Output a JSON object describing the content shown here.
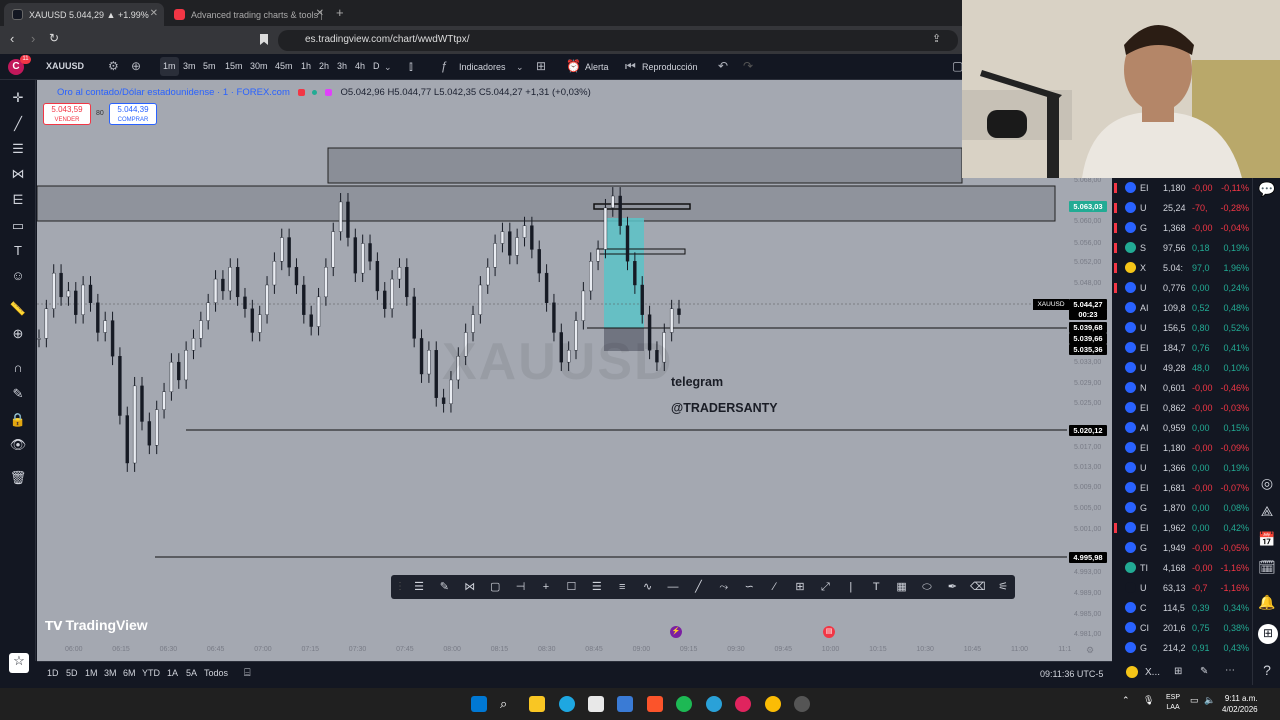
{
  "browser": {
    "tabs": [
      {
        "title": "XAUUSD 5.044,29 ▲ +1.99% do",
        "active": true
      },
      {
        "title": "Advanced trading charts & tools | Tra",
        "active": false
      }
    ],
    "url": "es.tradingview.com/chart/wwdWTtpx/"
  },
  "toolbar": {
    "avatar": "C",
    "notification_count": "11",
    "symbol": "XAUUSD",
    "timeframes": [
      "1m",
      "3m",
      "5m",
      "15m",
      "30m",
      "45m",
      "1h",
      "2h",
      "3h",
      "4h",
      "D"
    ],
    "active_timeframe": "1m",
    "indicators_label": "Indicadores",
    "alert_label": "Alerta",
    "replay_label": "Reproducción"
  },
  "legend": {
    "title": "Oro al contado/Dólar estadounidense · 1 · FOREX.com",
    "ohlc": "O5.042,96 H5.044,77 L5.042,35 C5.044,27 +1,31 (+0,03%)",
    "sell_price": "5.043,59",
    "sell_label": "VENDER",
    "spread": "80",
    "buy_price": "5.044,39",
    "buy_label": "COMPRAR"
  },
  "chart_watermark": "XAUUSD",
  "overlay_text": {
    "line1": "telegram",
    "line2": "@TRADERSANTY"
  },
  "brand": "TradingView",
  "chart_data": {
    "type": "line",
    "symbol": "XAUUSD",
    "x": [
      "06:00",
      "06:15",
      "06:30",
      "06:45",
      "07:00",
      "07:15",
      "07:30",
      "07:45",
      "08:00",
      "08:15",
      "08:30",
      "08:45",
      "09:00",
      "09:15",
      "09:30",
      "09:45",
      "10:00",
      "10:15",
      "10:30",
      "10:45",
      "11:00",
      "11:1"
    ],
    "y_ticks": [
      "5.068,00",
      "5.063,03",
      "5.060,00",
      "5.056,00",
      "5.052,00",
      "5.048,00",
      "5.044,27",
      "5.039,68",
      "5.039,66",
      "5.035,36",
      "5.033,00",
      "5.029,00",
      "5.025,00",
      "5.020,12",
      "5.017,00",
      "5.013,00",
      "5.009,00",
      "5.005,00",
      "5.001,00",
      "4.995,98",
      "4.993,00",
      "4.989,00",
      "4.985,00",
      "4.981,00"
    ],
    "price_labels": {
      "top_zone": "5.063,03",
      "current": "5.044,27",
      "countdown": "00:23",
      "level_a": "5.039,68",
      "level_b": "5.039,66",
      "level_c": "5.035,36",
      "support": "5.020,12",
      "low_line": "4.995,98"
    },
    "ylim": [
      4980,
      5069
    ],
    "series": [
      {
        "values": [
          5040,
          5045,
          5051,
          5047,
          5048,
          5044,
          5049,
          5046,
          5041,
          5043,
          5037,
          5027,
          5019,
          5032,
          5026,
          5022,
          5028,
          5031,
          5036,
          5033,
          5038,
          5040,
          5043,
          5046,
          5050,
          5048,
          5052,
          5047,
          5045,
          5041,
          5044,
          5049,
          5053,
          5057,
          5052,
          5049,
          5044,
          5042,
          5047,
          5052,
          5058,
          5063,
          5057,
          5051,
          5056,
          5053,
          5048,
          5045,
          5050,
          5052,
          5047,
          5040,
          5034,
          5038,
          5030,
          5029,
          5033,
          5037,
          5041,
          5044,
          5049,
          5052,
          5056,
          5058,
          5054,
          5057,
          5059,
          5055,
          5051,
          5046,
          5041,
          5036,
          5038,
          5043,
          5048,
          5053,
          5055,
          5062,
          5064,
          5059,
          5053,
          5049,
          5044,
          5038,
          5036,
          5041,
          5045,
          5044
        ]
      }
    ]
  },
  "drawing_toolbar": [
    "list-icon",
    "pencil-icon",
    "pitchfork-icon",
    "rect-icon",
    "hline-icon",
    "crosshair-icon",
    "note-icon",
    "lines-icon",
    "lines2-icon",
    "wave-icon",
    "minus-icon",
    "line-icon",
    "path-icon",
    "curve-icon",
    "brush-icon",
    "frame-icon",
    "ruler-icon",
    "pipe-icon",
    "text-icon",
    "grid-icon",
    "ellipse-icon",
    "pen-icon",
    "eraser-icon",
    "highlighter-icon"
  ],
  "range_bar": {
    "ranges": [
      "1D",
      "5D",
      "1M",
      "3M",
      "6M",
      "YTD",
      "1A",
      "5A",
      "Todos"
    ],
    "clock": "09:11:36 UTC-5"
  },
  "watchlist": [
    {
      "sym": "EI",
      "last": "1,180",
      "chg": "-0,00",
      "pct": "-0,11%",
      "up": false,
      "icon_color": "#2962ff"
    },
    {
      "sym": "U",
      "last": "25,24",
      "chg": "-70,",
      "pct": "-0,28%",
      "up": false,
      "icon_color": "#2962ff"
    },
    {
      "sym": "G",
      "last": "1,368",
      "chg": "-0,00",
      "pct": "-0,04%",
      "up": false,
      "icon_color": "#2962ff"
    },
    {
      "sym": "S",
      "last": "97,56",
      "chg": "0,18",
      "pct": "0,19%",
      "up": true,
      "icon_color": "#22ab94"
    },
    {
      "sym": "X",
      "last": "5.04:",
      "chg": "97,0",
      "pct": "1,96%",
      "up": true,
      "icon_color": "#f5c518"
    },
    {
      "sym": "U",
      "last": "0,776",
      "chg": "0,00",
      "pct": "0,24%",
      "up": true,
      "icon_color": "#2962ff"
    },
    {
      "sym": "AI",
      "last": "109,8",
      "chg": "0,52",
      "pct": "0,48%",
      "up": true,
      "icon_color": "#2962ff"
    },
    {
      "sym": "U",
      "last": "156,5",
      "chg": "0,80",
      "pct": "0,52%",
      "up": true,
      "icon_color": "#2962ff"
    },
    {
      "sym": "EI",
      "last": "184,7",
      "chg": "0,76",
      "pct": "0,41%",
      "up": true,
      "icon_color": "#2962ff"
    },
    {
      "sym": "U",
      "last": "49,28",
      "chg": "48,0",
      "pct": "0,10%",
      "up": true,
      "icon_color": "#2962ff"
    },
    {
      "sym": "N",
      "last": "0,601",
      "chg": "-0,00",
      "pct": "-0,46%",
      "up": false,
      "icon_color": "#2962ff"
    },
    {
      "sym": "EI",
      "last": "0,862",
      "chg": "-0,00",
      "pct": "-0,03%",
      "up": false,
      "icon_color": "#2962ff"
    },
    {
      "sym": "AI",
      "last": "0,959",
      "chg": "0,00",
      "pct": "0,15%",
      "up": true,
      "icon_color": "#2962ff"
    },
    {
      "sym": "EI",
      "last": "1,180",
      "chg": "-0,00",
      "pct": "-0,09%",
      "up": false,
      "icon_color": "#2962ff"
    },
    {
      "sym": "U",
      "last": "1,366",
      "chg": "0,00",
      "pct": "0,19%",
      "up": true,
      "icon_color": "#2962ff"
    },
    {
      "sym": "EI",
      "last": "1,681",
      "chg": "-0,00",
      "pct": "-0,07%",
      "up": false,
      "icon_color": "#2962ff"
    },
    {
      "sym": "G",
      "last": "1,870",
      "chg": "0,00",
      "pct": "0,08%",
      "up": true,
      "icon_color": "#2962ff"
    },
    {
      "sym": "EI",
      "last": "1,962",
      "chg": "0,00",
      "pct": "0,42%",
      "up": true,
      "icon_color": "#2962ff"
    },
    {
      "sym": "G",
      "last": "1,949",
      "chg": "-0,00",
      "pct": "-0,05%",
      "up": false,
      "icon_color": "#2962ff"
    },
    {
      "sym": "TI",
      "last": "4,168",
      "chg": "-0,00",
      "pct": "-1,16%",
      "up": false,
      "icon_color": "#22ab94"
    },
    {
      "sym": "U",
      "last": "63,13",
      "chg": "-0,7",
      "pct": "-1,16%",
      "up": false,
      "icon_color": "#131722"
    },
    {
      "sym": "C",
      "last": "114,5",
      "chg": "0,39",
      "pct": "0,34%",
      "up": true,
      "icon_color": "#2962ff"
    },
    {
      "sym": "CI",
      "last": "201,6",
      "chg": "0,75",
      "pct": "0,38%",
      "up": true,
      "icon_color": "#2962ff"
    },
    {
      "sym": "G",
      "last": "214,2",
      "chg": "0,91",
      "pct": "0,43%",
      "up": true,
      "icon_color": "#2962ff"
    }
  ],
  "watchlist_footer": "X...",
  "colors": {
    "up": "#22ab94",
    "down": "#f23645",
    "accent": "#2962ff",
    "chart_bg": "#a4a8b1"
  },
  "taskbar": {
    "lang_top": "ESP",
    "lang_bottom": "LAA",
    "time": "9:11 a.m.",
    "date": "4/02/2026"
  }
}
